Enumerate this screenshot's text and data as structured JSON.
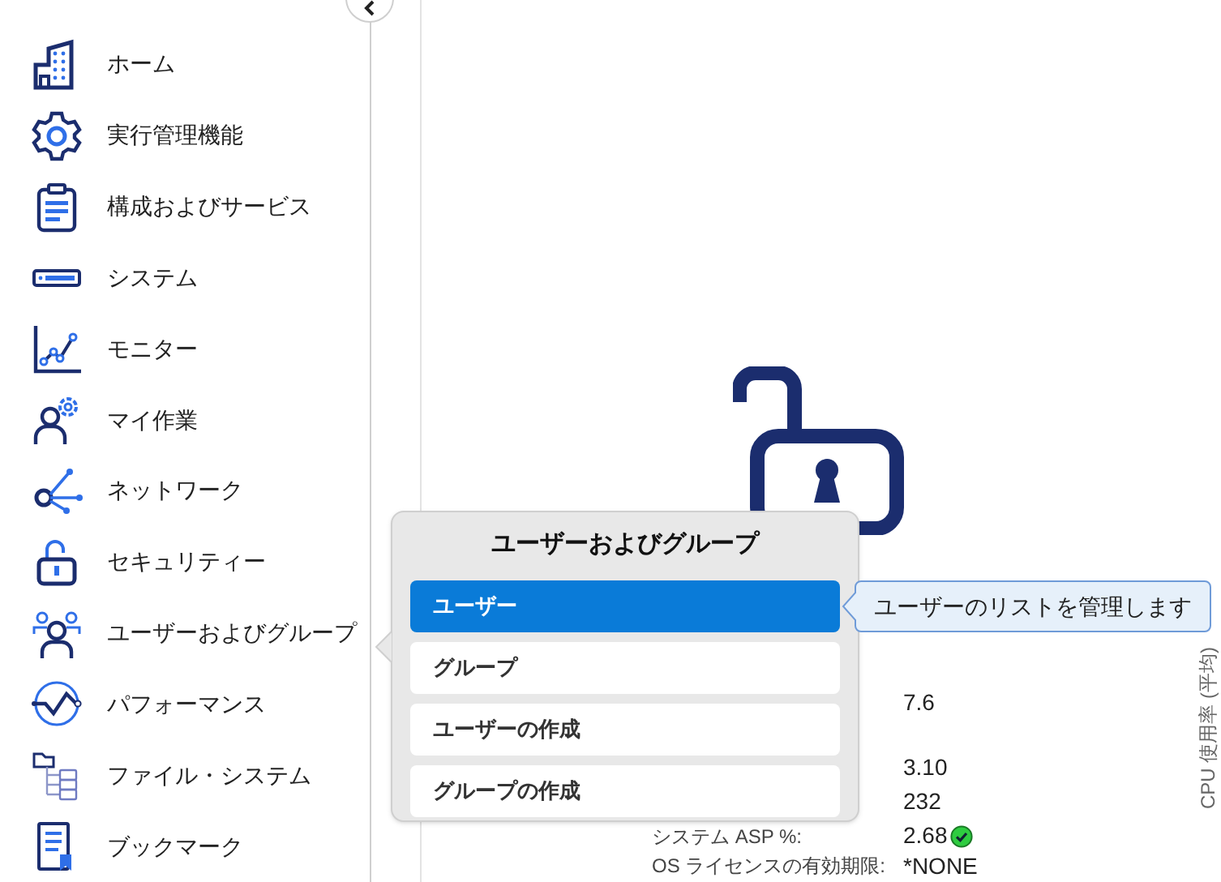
{
  "sidebar": {
    "items": [
      {
        "label": "ホーム"
      },
      {
        "label": "実行管理機能"
      },
      {
        "label": "構成およびサービス"
      },
      {
        "label": "システム"
      },
      {
        "label": "モニター"
      },
      {
        "label": "マイ作業"
      },
      {
        "label": "ネットワーク"
      },
      {
        "label": "セキュリティー"
      },
      {
        "label": "ユーザーおよびグループ"
      },
      {
        "label": "パフォーマンス"
      },
      {
        "label": "ファイル・システム"
      },
      {
        "label": "ブックマーク"
      }
    ]
  },
  "content": {
    "rows": [
      {
        "value": "7.6"
      },
      {
        "value": "3.10"
      },
      {
        "value": "232"
      },
      {
        "label": "システム ASP %:",
        "value": "2.68",
        "ok": true
      },
      {
        "label": "OS ライセンスの有効期限:",
        "value": "*NONE"
      }
    ],
    "axis_label": "CPU 使用率 (平均)"
  },
  "popup": {
    "title": "ユーザーおよびグループ",
    "items": [
      {
        "label": "ユーザー",
        "selected": true
      },
      {
        "label": "グループ",
        "selected": false
      },
      {
        "label": "ユーザーの作成",
        "selected": false
      },
      {
        "label": "グループの作成",
        "selected": false
      }
    ],
    "tooltip": "ユーザーのリストを管理します"
  }
}
